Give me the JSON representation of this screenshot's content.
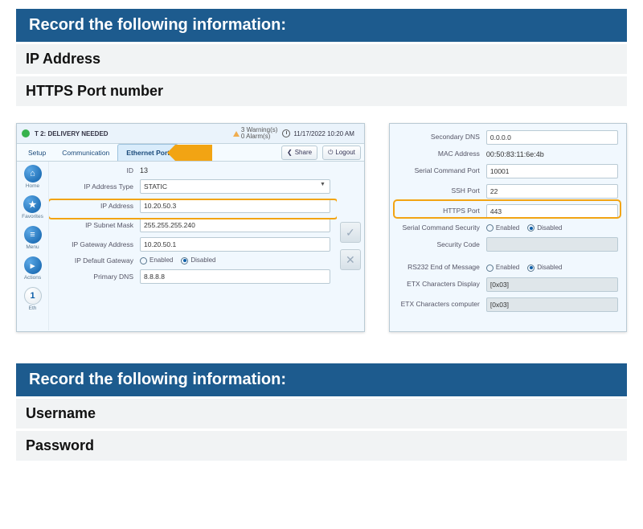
{
  "table1": {
    "heading": "Record the following information:",
    "rows": [
      {
        "label": "IP Address",
        "value": ""
      },
      {
        "label": "HTTPS Port number",
        "value": ""
      }
    ]
  },
  "table2": {
    "heading": "Record the following information:",
    "rows": [
      {
        "label": "Username",
        "value": ""
      },
      {
        "label": "Password",
        "value": ""
      }
    ]
  },
  "screenLeft": {
    "status_title": "T 2: DELIVERY NEEDED",
    "warning_text": "3 Warning(s)",
    "alarm_text": "0 Alarm(s)",
    "datetime": "11/17/2022 10:20 AM",
    "tabs": {
      "setup": "Setup",
      "comm": "Communication",
      "eth": "Ethernet Port"
    },
    "buttons": {
      "share": "Share",
      "logout": "Logout"
    },
    "sidebar": {
      "home": "Home",
      "favorites": "Favorites",
      "menu": "Menu",
      "actions": "Actions",
      "eth_num": "1",
      "eth_label": "Eth"
    },
    "form": {
      "id_label": "ID",
      "id_value": "13",
      "type_label": "IP Address Type",
      "type_value": "STATIC",
      "ip_label": "IP Address",
      "ip_value": "10.20.50.3",
      "subnet_label": "IP Subnet Mask",
      "subnet_value": "255.255.255.240",
      "gw_label": "IP Gateway Address",
      "gw_value": "10.20.50.1",
      "defgw_label": "IP Default Gateway",
      "defgw_enabled": "Enabled",
      "defgw_disabled": "Disabled",
      "dns_label": "Primary DNS",
      "dns_value": "8.8.8.8"
    },
    "actions": {
      "ok": "✓",
      "cancel": "✕"
    }
  },
  "screenRight": {
    "fields": {
      "sec_dns_label": "Secondary DNS",
      "sec_dns_value": "0.0.0.0",
      "mac_label": "MAC Address",
      "mac_value": "00:50:83:11:6e:4b",
      "scp_label": "Serial Command Port",
      "scp_value": "10001",
      "ssh_label": "SSH Port",
      "ssh_value": "22",
      "https_label": "HTTPS Port",
      "https_value": "443",
      "scs_label": "Serial Command Security",
      "enabled": "Enabled",
      "disabled": "Disabled",
      "seccode_label": "Security Code",
      "seccode_value": "",
      "rs232_label": "RS232 End of Message",
      "etx_disp_label": "ETX Characters Display",
      "etx_disp_value": "[0x03]",
      "etx_comp_label": "ETX Characters computer",
      "etx_comp_value": "[0x03]"
    }
  }
}
